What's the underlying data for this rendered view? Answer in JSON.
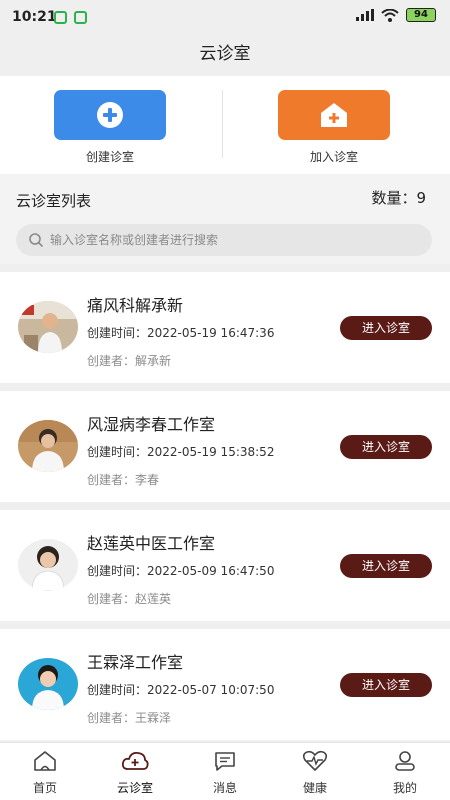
{
  "status": {
    "time": "10:21",
    "battery": "94",
    "network": "HD"
  },
  "header": {
    "title": "云诊室"
  },
  "actions": [
    {
      "label": "创建诊室",
      "icon": "plus-circle-icon",
      "color": "#3d8be8"
    },
    {
      "label": "加入诊室",
      "icon": "house-plus-icon",
      "color": "#f07a2c"
    }
  ],
  "list": {
    "title": "云诊室列表",
    "count_label": "数量：9",
    "search_placeholder": "输入诊室名称或创建者进行搜索"
  },
  "clinics": [
    {
      "name": "痛风科解承新",
      "created": "创建时间：2022-05-19 16:47:36",
      "creator": "创建者：解承新",
      "button": "进入诊室"
    },
    {
      "name": "风湿病李春工作室",
      "created": "创建时间：2022-05-19 15:38:52",
      "creator": "创建者：李春",
      "button": "进入诊室"
    },
    {
      "name": "赵莲英中医工作室",
      "created": "创建时间：2022-05-09 16:47:50",
      "creator": "创建者：赵莲英",
      "button": "进入诊室"
    },
    {
      "name": "王霖泽工作室",
      "created": "创建时间：2022-05-07 10:07:50",
      "creator": "创建者：王霖泽",
      "button": "进入诊室"
    }
  ],
  "tabs": [
    {
      "label": "首页",
      "icon": "home-icon"
    },
    {
      "label": "云诊室",
      "icon": "cloud-plus-icon",
      "active": true
    },
    {
      "label": "消息",
      "icon": "message-icon"
    },
    {
      "label": "健康",
      "icon": "heart-pulse-icon"
    },
    {
      "label": "我的",
      "icon": "user-icon"
    }
  ],
  "colors": {
    "accent_button": "#5a1a16",
    "create_blue": "#3d8be8",
    "join_orange": "#f07a2c"
  }
}
